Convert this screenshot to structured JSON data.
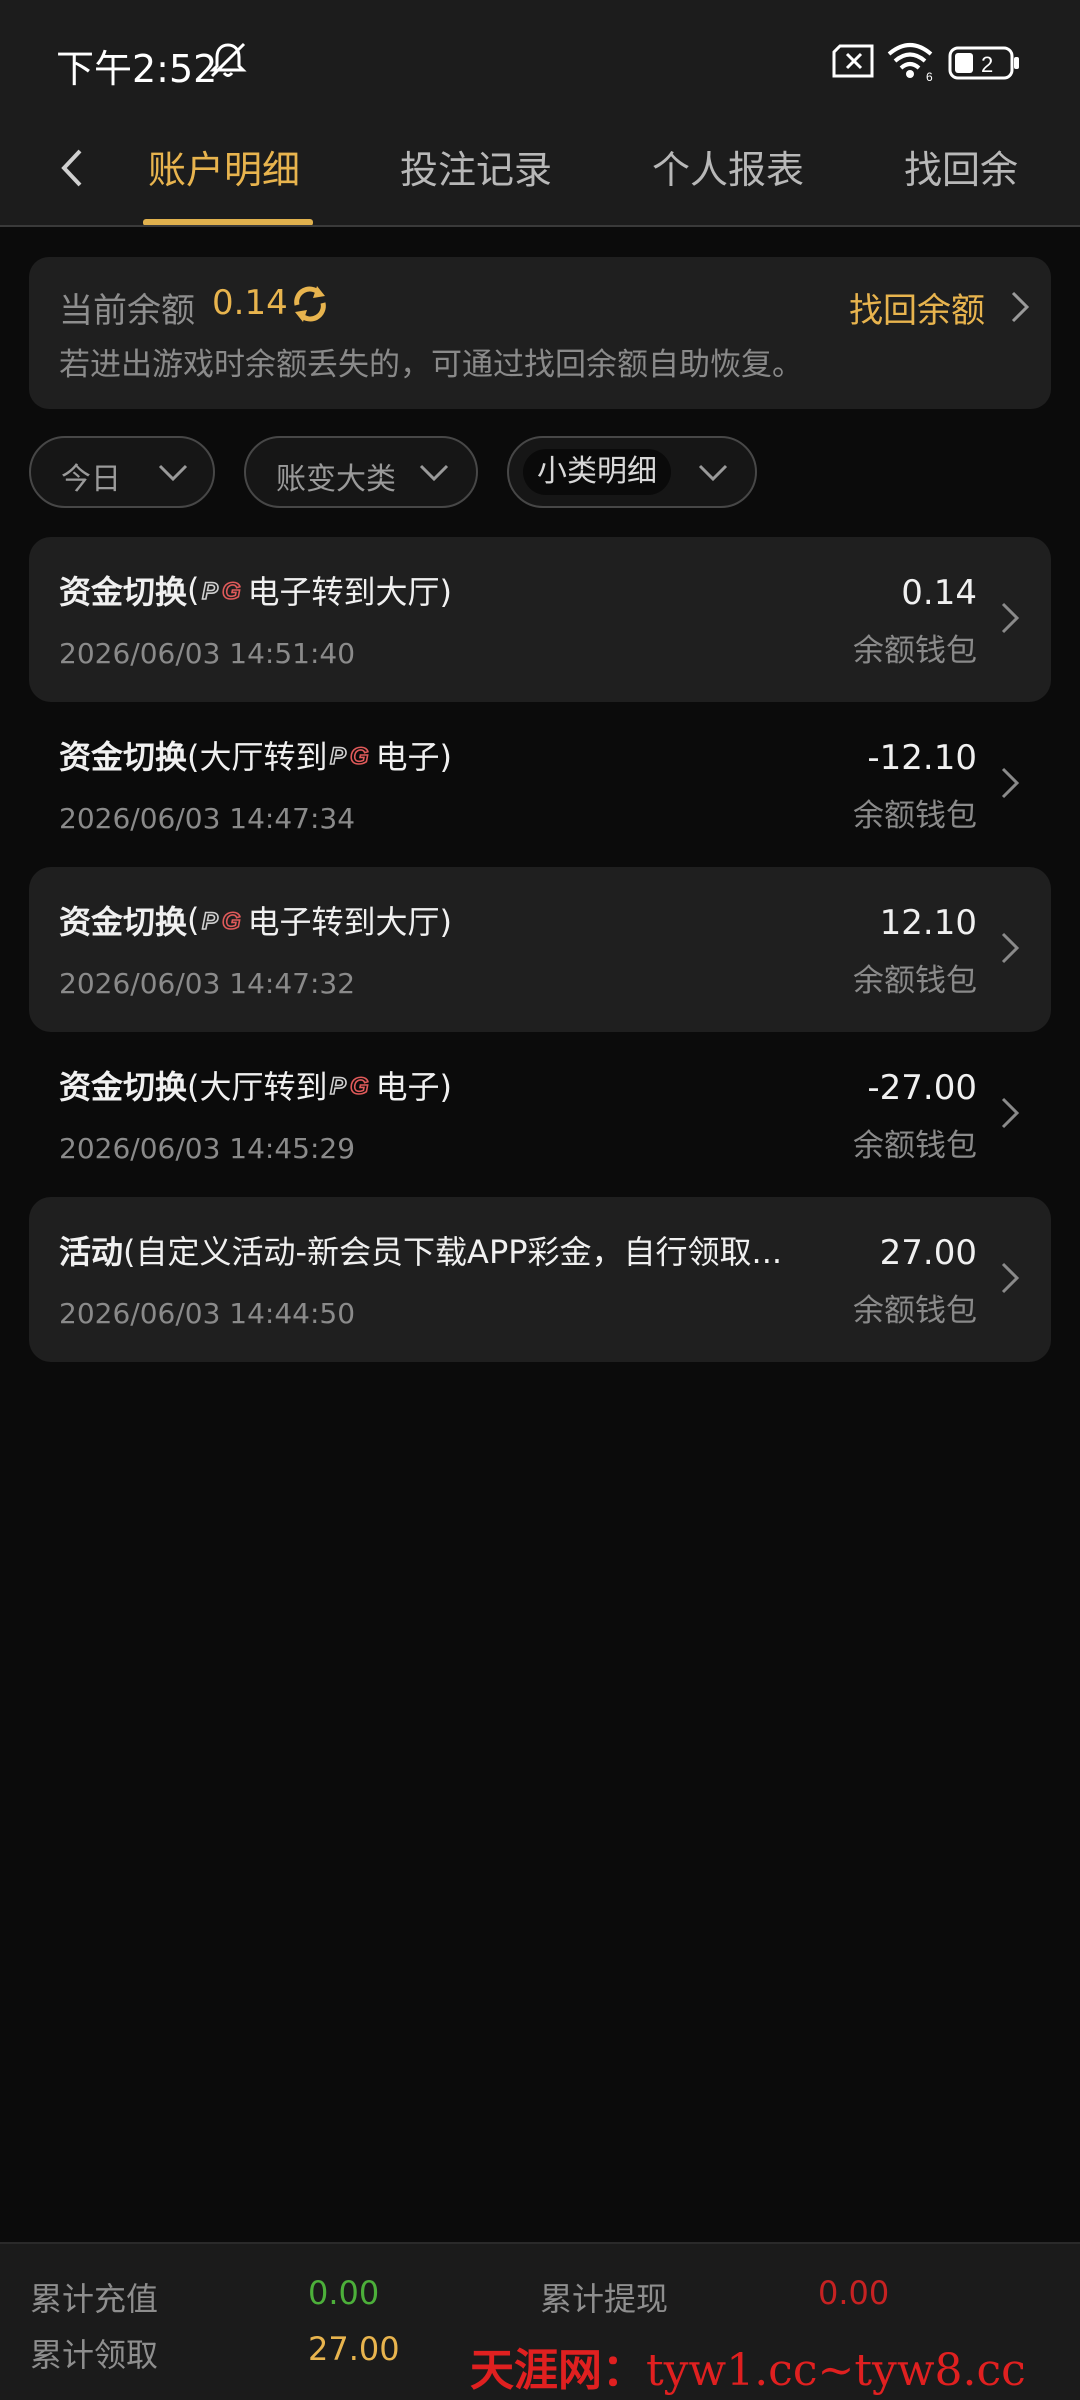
{
  "status_bar": {
    "time": "下午2:52",
    "battery": "2"
  },
  "tabs": {
    "active": "账户明细",
    "bet_records": "投注记录",
    "personal_report": "个人报表",
    "recover_partial": "找回余"
  },
  "balance": {
    "label": "当前余额",
    "value": "0.14",
    "recover_label": "找回余额",
    "hint": "若进出游戏时余额丢失的，可通过找回余额自助恢复。"
  },
  "filters": {
    "date": "今日",
    "category": "账变大类",
    "subcategory": "小类明细"
  },
  "records": [
    {
      "type": "资金切换",
      "pre": " (",
      "post": "电子转到大厅)",
      "show_pg": true,
      "pg_first": true,
      "time": "2026/06/03 14:51:40",
      "amount": "0.14",
      "wallet": "余额钱包"
    },
    {
      "type": "资金切换",
      "pre": " (大厅转到",
      "post": "电子)",
      "show_pg": true,
      "pg_first": false,
      "time": "2026/06/03 14:47:34",
      "amount": "-12.10",
      "wallet": "余额钱包"
    },
    {
      "type": "资金切换",
      "pre": " (",
      "post": "电子转到大厅)",
      "show_pg": true,
      "pg_first": true,
      "time": "2026/06/03 14:47:32",
      "amount": "12.10",
      "wallet": "余额钱包"
    },
    {
      "type": "资金切换",
      "pre": " (大厅转到",
      "post": "电子)",
      "show_pg": true,
      "pg_first": false,
      "time": "2026/06/03 14:45:29",
      "amount": "-27.00",
      "wallet": "余额钱包"
    },
    {
      "type": "活动",
      "pre": " (自定义活动-新会员下载APP彩金，自行领取...",
      "post": "",
      "show_pg": false,
      "pg_first": false,
      "time": "2026/06/03 14:44:50",
      "amount": "27.00",
      "wallet": "余额钱包"
    }
  ],
  "footer": {
    "deposit_label": "累计充值",
    "deposit_value": "0.00",
    "withdraw_label": "累计提现",
    "withdraw_value": "0.00",
    "claim_label": "累计领取",
    "claim_value": "27.00",
    "deposit_color": "#4caf3a",
    "withdraw_color": "#c62222",
    "claim_color": "#e8b44e"
  },
  "watermark": {
    "site_name": "天涯网：",
    "domains": "tyw1.cc~tyw8.cc"
  },
  "colors": {
    "accent": "#e8b44e",
    "background": "#0b0b0b",
    "card": "#1f1f1f"
  },
  "icons": [
    "bell-off-icon",
    "sim-icon",
    "wifi-icon",
    "battery-icon",
    "back-icon",
    "refresh-icon",
    "chevron-right-icon",
    "chevron-down-icon",
    "pg-logo-icon"
  ]
}
